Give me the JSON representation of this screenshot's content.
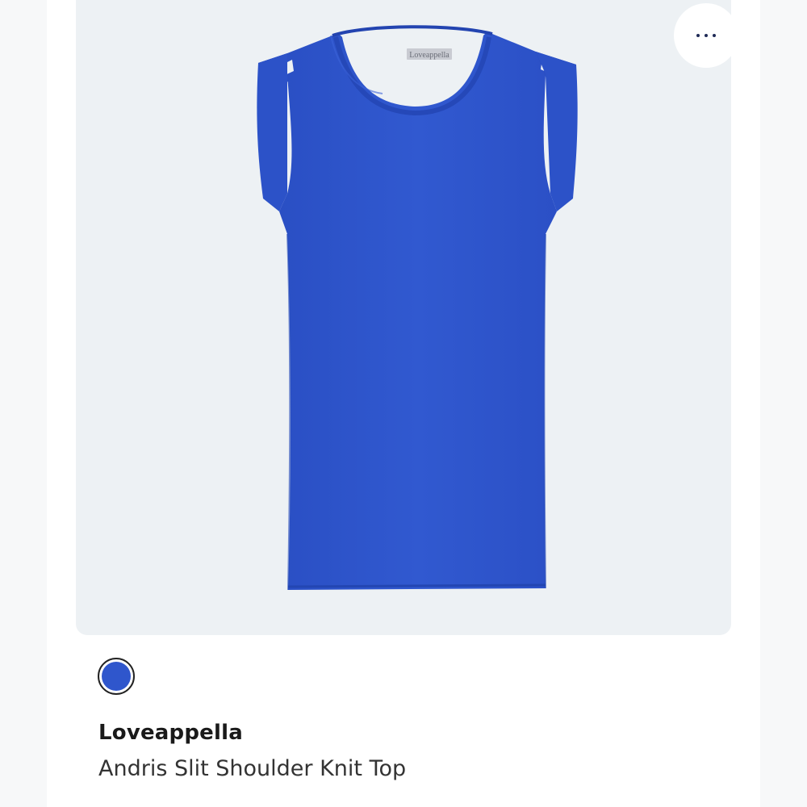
{
  "product": {
    "brand": "Loveappella",
    "name": "Andris Slit Shoulder Knit Top",
    "label_tag": "Loveappella",
    "garment_color": "#2f56cc",
    "swatch_color": "#2f56cc",
    "more_options_icon": "ellipsis-horizontal-icon"
  },
  "colors": {
    "image_background": "#edf1f4",
    "swatch_border": "#222222",
    "icon_color": "#1f2a56"
  }
}
